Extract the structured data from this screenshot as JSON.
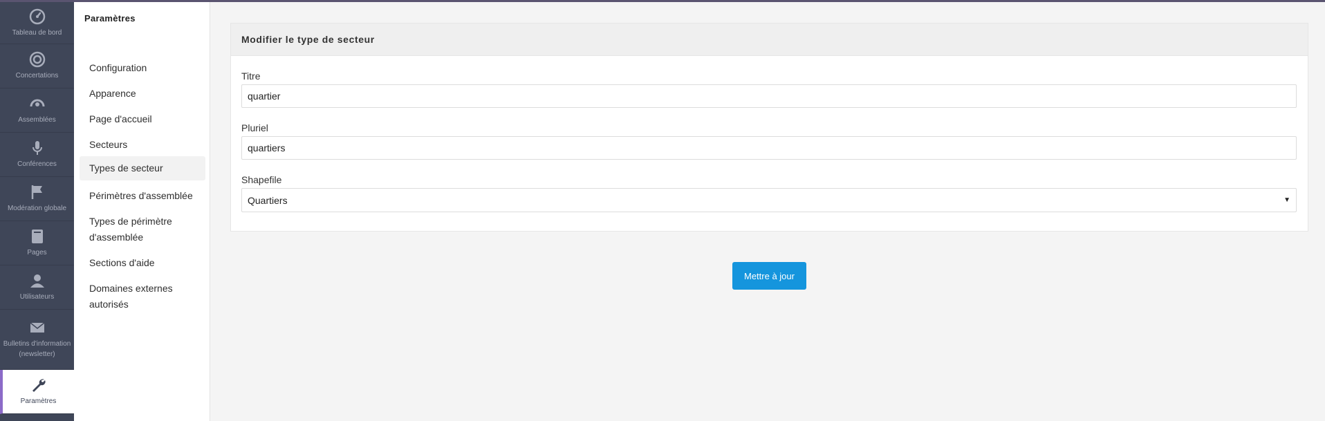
{
  "rail": {
    "items": [
      {
        "label": "Tableau de bord",
        "icon": "dashboard-icon"
      },
      {
        "label": "Concertations",
        "icon": "target-icon"
      },
      {
        "label": "Assemblées",
        "icon": "assembly-icon"
      },
      {
        "label": "Conférences",
        "icon": "microphone-icon"
      },
      {
        "label": "Modération globale",
        "icon": "flag-icon"
      },
      {
        "label": "Pages",
        "icon": "book-icon"
      },
      {
        "label": "Utilisateurs",
        "icon": "user-icon"
      },
      {
        "label": "Bulletins d'information (newsletter)",
        "icon": "envelope-icon"
      },
      {
        "label": "Paramètres",
        "icon": "wrench-icon"
      }
    ]
  },
  "submenu": {
    "title": "Paramètres",
    "items": [
      {
        "label": "Configuration"
      },
      {
        "label": "Apparence"
      },
      {
        "label": "Page d'accueil"
      },
      {
        "label": "Secteurs"
      },
      {
        "label": "Types de secteur"
      },
      {
        "label": "Périmètres d'assemblée"
      },
      {
        "label": "Types de périmètre d'assemblée"
      },
      {
        "label": "Sections d'aide"
      },
      {
        "label": "Domaines externes autorisés"
      }
    ]
  },
  "form": {
    "header": "Modifier le type de secteur",
    "title_label": "Titre",
    "title_value": "quartier",
    "plural_label": "Pluriel",
    "plural_value": "quartiers",
    "shapefile_label": "Shapefile",
    "shapefile_value": "Quartiers",
    "submit_label": "Mettre à jour"
  },
  "colors": {
    "rail_bg": "#3f4658",
    "rail_active_accent": "#8c6bc8",
    "primary_button": "#1595dd"
  }
}
